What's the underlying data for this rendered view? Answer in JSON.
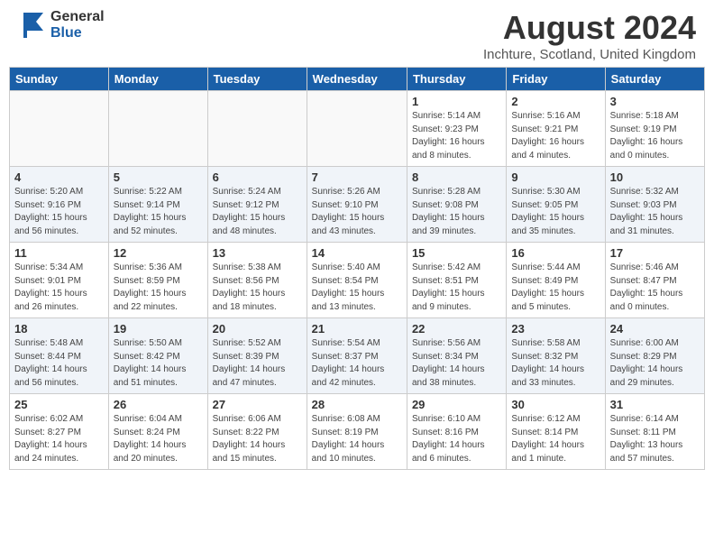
{
  "header": {
    "logo_general": "General",
    "logo_blue": "Blue",
    "month_year": "August 2024",
    "location": "Inchture, Scotland, United Kingdom"
  },
  "weekdays": [
    "Sunday",
    "Monday",
    "Tuesday",
    "Wednesday",
    "Thursday",
    "Friday",
    "Saturday"
  ],
  "weeks": [
    [
      {
        "day": "",
        "info": ""
      },
      {
        "day": "",
        "info": ""
      },
      {
        "day": "",
        "info": ""
      },
      {
        "day": "",
        "info": ""
      },
      {
        "day": "1",
        "info": "Sunrise: 5:14 AM\nSunset: 9:23 PM\nDaylight: 16 hours\nand 8 minutes."
      },
      {
        "day": "2",
        "info": "Sunrise: 5:16 AM\nSunset: 9:21 PM\nDaylight: 16 hours\nand 4 minutes."
      },
      {
        "day": "3",
        "info": "Sunrise: 5:18 AM\nSunset: 9:19 PM\nDaylight: 16 hours\nand 0 minutes."
      }
    ],
    [
      {
        "day": "4",
        "info": "Sunrise: 5:20 AM\nSunset: 9:16 PM\nDaylight: 15 hours\nand 56 minutes."
      },
      {
        "day": "5",
        "info": "Sunrise: 5:22 AM\nSunset: 9:14 PM\nDaylight: 15 hours\nand 52 minutes."
      },
      {
        "day": "6",
        "info": "Sunrise: 5:24 AM\nSunset: 9:12 PM\nDaylight: 15 hours\nand 48 minutes."
      },
      {
        "day": "7",
        "info": "Sunrise: 5:26 AM\nSunset: 9:10 PM\nDaylight: 15 hours\nand 43 minutes."
      },
      {
        "day": "8",
        "info": "Sunrise: 5:28 AM\nSunset: 9:08 PM\nDaylight: 15 hours\nand 39 minutes."
      },
      {
        "day": "9",
        "info": "Sunrise: 5:30 AM\nSunset: 9:05 PM\nDaylight: 15 hours\nand 35 minutes."
      },
      {
        "day": "10",
        "info": "Sunrise: 5:32 AM\nSunset: 9:03 PM\nDaylight: 15 hours\nand 31 minutes."
      }
    ],
    [
      {
        "day": "11",
        "info": "Sunrise: 5:34 AM\nSunset: 9:01 PM\nDaylight: 15 hours\nand 26 minutes."
      },
      {
        "day": "12",
        "info": "Sunrise: 5:36 AM\nSunset: 8:59 PM\nDaylight: 15 hours\nand 22 minutes."
      },
      {
        "day": "13",
        "info": "Sunrise: 5:38 AM\nSunset: 8:56 PM\nDaylight: 15 hours\nand 18 minutes."
      },
      {
        "day": "14",
        "info": "Sunrise: 5:40 AM\nSunset: 8:54 PM\nDaylight: 15 hours\nand 13 minutes."
      },
      {
        "day": "15",
        "info": "Sunrise: 5:42 AM\nSunset: 8:51 PM\nDaylight: 15 hours\nand 9 minutes."
      },
      {
        "day": "16",
        "info": "Sunrise: 5:44 AM\nSunset: 8:49 PM\nDaylight: 15 hours\nand 5 minutes."
      },
      {
        "day": "17",
        "info": "Sunrise: 5:46 AM\nSunset: 8:47 PM\nDaylight: 15 hours\nand 0 minutes."
      }
    ],
    [
      {
        "day": "18",
        "info": "Sunrise: 5:48 AM\nSunset: 8:44 PM\nDaylight: 14 hours\nand 56 minutes."
      },
      {
        "day": "19",
        "info": "Sunrise: 5:50 AM\nSunset: 8:42 PM\nDaylight: 14 hours\nand 51 minutes."
      },
      {
        "day": "20",
        "info": "Sunrise: 5:52 AM\nSunset: 8:39 PM\nDaylight: 14 hours\nand 47 minutes."
      },
      {
        "day": "21",
        "info": "Sunrise: 5:54 AM\nSunset: 8:37 PM\nDaylight: 14 hours\nand 42 minutes."
      },
      {
        "day": "22",
        "info": "Sunrise: 5:56 AM\nSunset: 8:34 PM\nDaylight: 14 hours\nand 38 minutes."
      },
      {
        "day": "23",
        "info": "Sunrise: 5:58 AM\nSunset: 8:32 PM\nDaylight: 14 hours\nand 33 minutes."
      },
      {
        "day": "24",
        "info": "Sunrise: 6:00 AM\nSunset: 8:29 PM\nDaylight: 14 hours\nand 29 minutes."
      }
    ],
    [
      {
        "day": "25",
        "info": "Sunrise: 6:02 AM\nSunset: 8:27 PM\nDaylight: 14 hours\nand 24 minutes."
      },
      {
        "day": "26",
        "info": "Sunrise: 6:04 AM\nSunset: 8:24 PM\nDaylight: 14 hours\nand 20 minutes."
      },
      {
        "day": "27",
        "info": "Sunrise: 6:06 AM\nSunset: 8:22 PM\nDaylight: 14 hours\nand 15 minutes."
      },
      {
        "day": "28",
        "info": "Sunrise: 6:08 AM\nSunset: 8:19 PM\nDaylight: 14 hours\nand 10 minutes."
      },
      {
        "day": "29",
        "info": "Sunrise: 6:10 AM\nSunset: 8:16 PM\nDaylight: 14 hours\nand 6 minutes."
      },
      {
        "day": "30",
        "info": "Sunrise: 6:12 AM\nSunset: 8:14 PM\nDaylight: 14 hours\nand 1 minute."
      },
      {
        "day": "31",
        "info": "Sunrise: 6:14 AM\nSunset: 8:11 PM\nDaylight: 13 hours\nand 57 minutes."
      }
    ]
  ]
}
